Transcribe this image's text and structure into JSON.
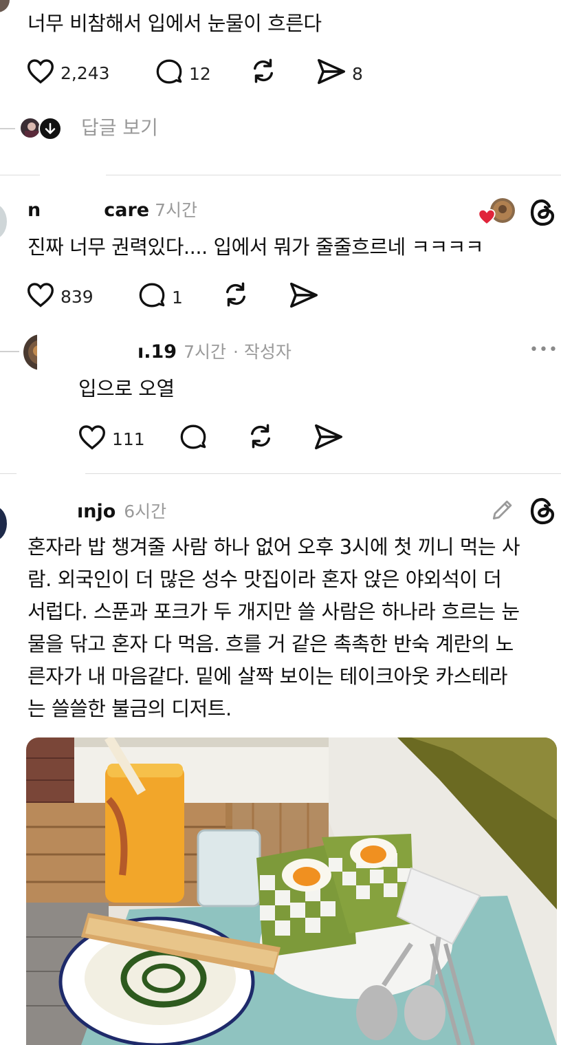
{
  "post1": {
    "text": "너무 비참해서 입에서 눈물이 흐른다",
    "likes": "2,243",
    "replies": "12",
    "shares": "8",
    "view_replies": "답글 보기"
  },
  "post2": {
    "username_start": "n",
    "username_end": "care",
    "time": "7시간",
    "text": "진짜 너무 권력있다.... 입에서 뭐가 줄줄흐르네 ㅋㅋㅋㅋ",
    "likes": "839",
    "replies": "1"
  },
  "reply": {
    "username": "ı.19",
    "time": "7시간",
    "author_tag": "· 작성자",
    "more": "•••",
    "text": "입으로 오열",
    "likes": "111"
  },
  "post3": {
    "username": "ınjo",
    "time": "6시간",
    "lines": [
      "혼자라 밥 챙겨줄 사람 하나 없어 오후 3시에 첫 끼니 먹는 사",
      "람. 외국인이 더 많은 성수 맛집이라 혼자 앉은 야외석이 더",
      "서럽다. 스푼과 포크가 두 개지만 쓸 사람은 하나라 흐르는 눈",
      "물을 닦고 혼자 다 먹음. 흐를 거 같은 촉촉한 반숙 계란의 노",
      "른자가 내 마음같다. 밑에 살짝 보이는 테이크아웃 카스테라",
      "는 쓸쓸한 불금의 디저트."
    ]
  },
  "icons": {
    "like": "heart-icon",
    "reply": "comment-icon",
    "repost": "repost-icon",
    "share": "send-icon",
    "threads": "threads-logo-icon",
    "edit": "pencil-icon",
    "more": "more-icon"
  },
  "colors": {
    "text": "#101010",
    "muted": "#9a9a9a",
    "separator": "#dcdcdc",
    "like_red": "#e0243a"
  }
}
